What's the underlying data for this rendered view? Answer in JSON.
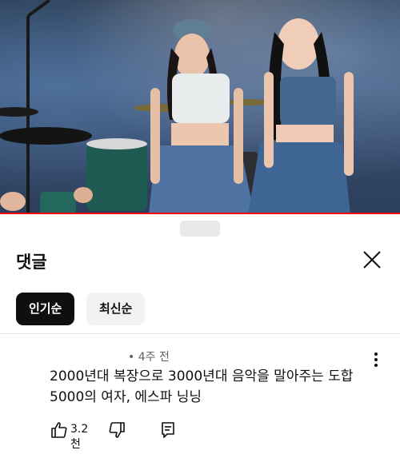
{
  "video": {
    "progress": 1.0,
    "progress_color": "#ff0000"
  },
  "sheet": {
    "title": "댓글",
    "close_icon": "close-icon"
  },
  "sort": {
    "chips": [
      {
        "label": "인기순",
        "active": true
      },
      {
        "label": "최신순",
        "active": false
      }
    ]
  },
  "comment": {
    "time": "• 4주 전",
    "text_line1": "2000년대 복장으로 3000년대 음악을 말아주는 도합",
    "text_line2": "5000의 여자, 에스파 닝닝",
    "like_count": "3.2천",
    "icons": [
      "thumbs-up-icon",
      "thumbs-down-icon",
      "reply-icon",
      "more-vert-icon"
    ]
  }
}
